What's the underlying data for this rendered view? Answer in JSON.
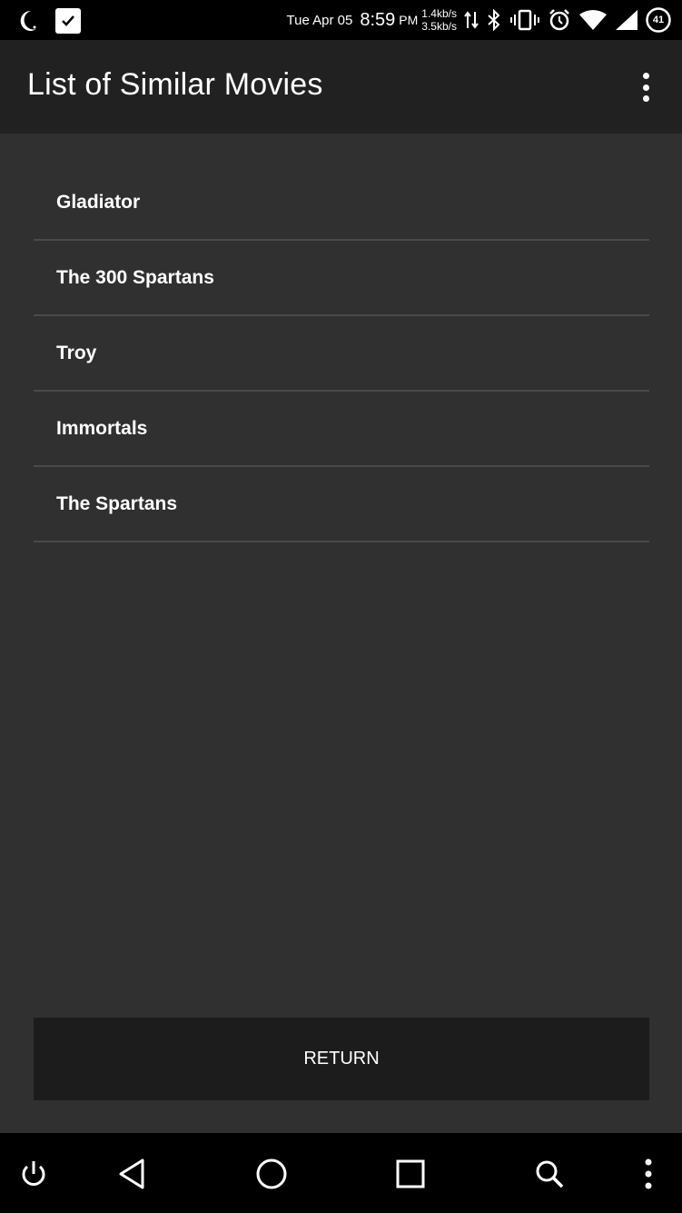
{
  "status_bar": {
    "date": "Tue Apr 05",
    "time": "8:59",
    "ampm": "PM",
    "upload_speed": "1.4kb/s",
    "download_speed": "3.5kb/s",
    "battery_level": "41",
    "icons": [
      "moon-icon",
      "task-check-icon",
      "data-arrows-icon",
      "bluetooth-icon",
      "vibrate-icon",
      "alarm-icon",
      "wifi-icon",
      "cell-signal-icon",
      "battery-icon"
    ]
  },
  "app_bar": {
    "title": "List of Similar Movies",
    "menu_icon": "overflow-menu-icon"
  },
  "movies": [
    {
      "title": "Gladiator"
    },
    {
      "title": "The 300 Spartans"
    },
    {
      "title": "Troy"
    },
    {
      "title": "Immortals"
    },
    {
      "title": "The Spartans"
    }
  ],
  "return_button": {
    "label": "RETURN"
  },
  "nav_bar": {
    "buttons": [
      "power-icon",
      "back-icon",
      "home-icon",
      "recents-icon",
      "search-icon",
      "more-icon"
    ]
  },
  "colors": {
    "background": "#303030",
    "app_bar": "#212121",
    "button": "#1c1c1c",
    "divider": "#4a4a4a",
    "text": "#ffffff"
  }
}
